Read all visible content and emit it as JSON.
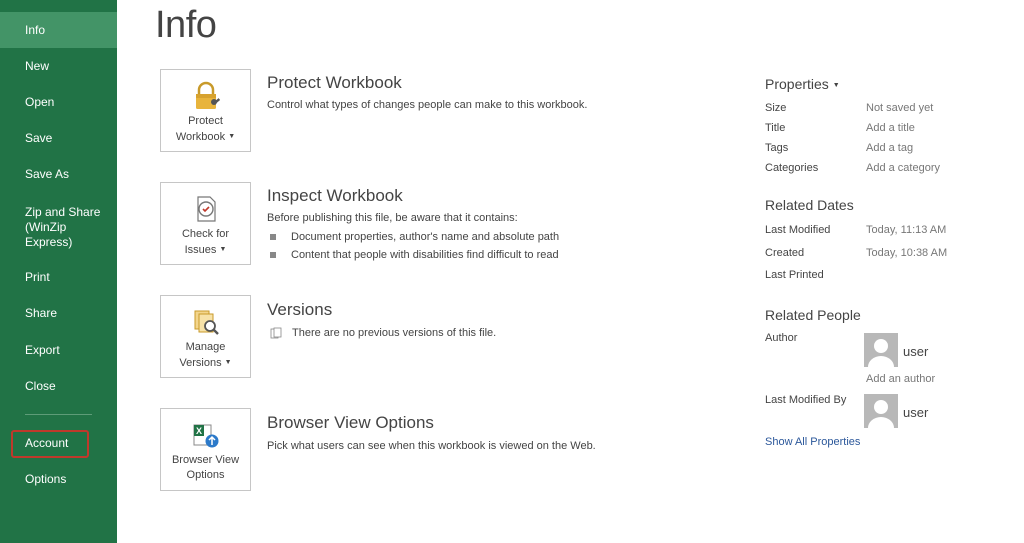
{
  "sidebar": {
    "items": [
      {
        "label": "Info"
      },
      {
        "label": "New"
      },
      {
        "label": "Open"
      },
      {
        "label": "Save"
      },
      {
        "label": "Save As"
      },
      {
        "label": "Zip and Share\n(WinZip\nExpress)"
      },
      {
        "label": "Print"
      },
      {
        "label": "Share"
      },
      {
        "label": "Export"
      },
      {
        "label": "Close"
      },
      {
        "label": "Account"
      },
      {
        "label": "Options"
      }
    ],
    "active": "Info",
    "bg_color": "#217346",
    "active_color": "#439467",
    "highlight_color": "#c0392b"
  },
  "page": {
    "title": "Info"
  },
  "sections": {
    "protect": {
      "button_line1": "Protect",
      "button_line2": "Workbook",
      "title": "Protect Workbook",
      "description": "Control what types of changes people can make to this workbook."
    },
    "inspect": {
      "button_line1": "Check for",
      "button_line2": "Issues",
      "title": "Inspect Workbook",
      "description": "Before publishing this file, be aware that it contains:",
      "bullets": [
        "Document properties, author's name and absolute path",
        "Content that people with disabilities find difficult to read"
      ]
    },
    "versions": {
      "button_line1": "Manage",
      "button_line2": "Versions",
      "title": "Versions",
      "description": "There are no previous versions of this file."
    },
    "browser": {
      "button_line1": "Browser View",
      "button_line2": "Options",
      "title": "Browser View Options",
      "description": "Pick what users can see when this workbook is viewed on the Web."
    }
  },
  "properties": {
    "heading": "Properties",
    "rows": [
      {
        "label": "Size",
        "value": "Not saved yet"
      },
      {
        "label": "Title",
        "value": "Add a title"
      },
      {
        "label": "Tags",
        "value": "Add a tag"
      },
      {
        "label": "Categories",
        "value": "Add a category"
      }
    ]
  },
  "related_dates": {
    "heading": "Related Dates",
    "last_modified_label": "Last Modified",
    "last_modified_value": "Today, 11:13 AM",
    "created_label": "Created",
    "created_value": "Today, 10:38 AM",
    "last_printed_label": "Last Printed"
  },
  "related_people": {
    "heading": "Related People",
    "author_label": "Author",
    "author_name": "user",
    "add_author": "Add an author",
    "last_modified_by_label": "Last Modified By",
    "last_modified_by_name": "user"
  },
  "show_all": "Show All Properties",
  "icons": {
    "protect": "lock-key-icon",
    "inspect": "document-check-icon",
    "versions": "document-search-icon",
    "browser": "excel-globe-icon",
    "avatar": "person-placeholder-icon"
  }
}
